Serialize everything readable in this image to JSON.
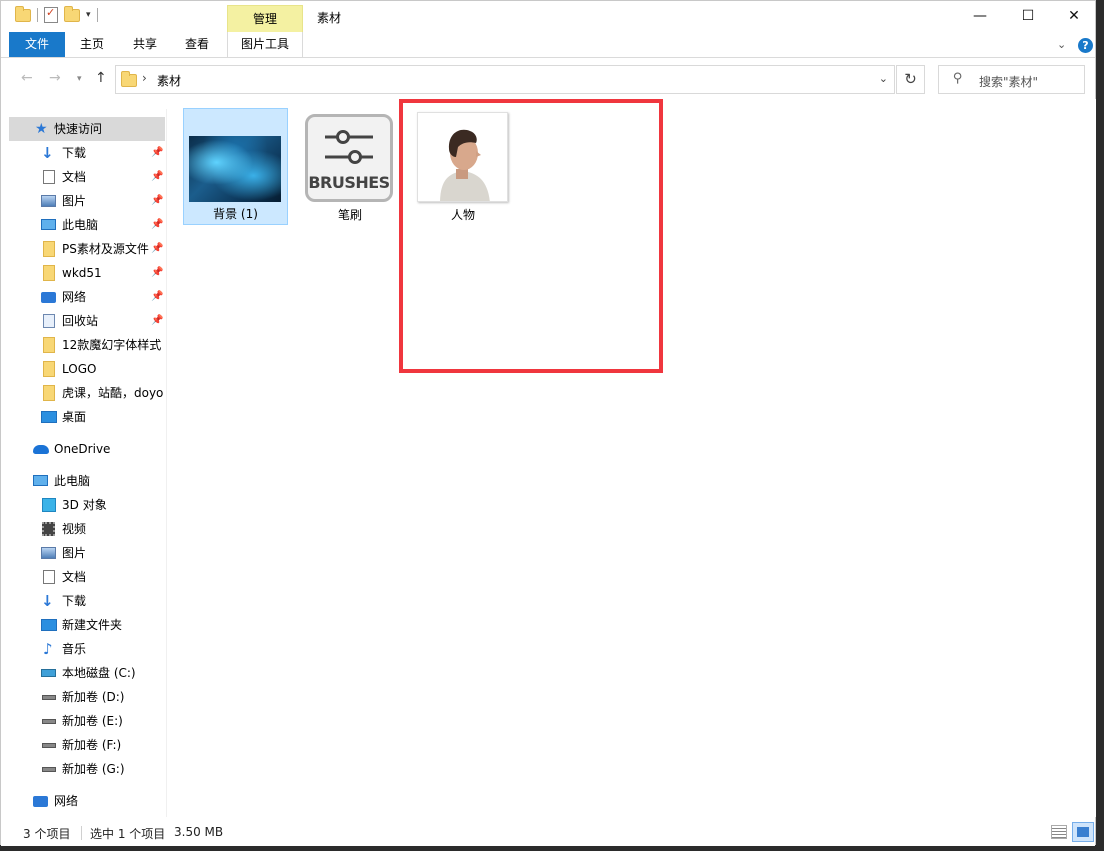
{
  "window": {
    "title": "素材",
    "contextual_tab": "管理",
    "controls": {
      "minimize": "—",
      "maximize": "☐",
      "close": "✕"
    }
  },
  "ribbon": {
    "tabs": [
      "文件",
      "主页",
      "共享",
      "查看",
      "图片工具"
    ],
    "collapse_icon": "chevron-down-icon",
    "help_label": "?"
  },
  "address": {
    "path": "素材",
    "search_placeholder": "搜索\"素材\""
  },
  "sidebar": {
    "quick_access": "快速访问",
    "quick_items": [
      {
        "label": "下载",
        "icon": "download-icon",
        "pinned": true
      },
      {
        "label": "文档",
        "icon": "document-icon",
        "pinned": true
      },
      {
        "label": "图片",
        "icon": "picture-icon",
        "pinned": true
      },
      {
        "label": "此电脑",
        "icon": "computer-icon",
        "pinned": true
      },
      {
        "label": "PS素材及源文件",
        "icon": "folder-icon",
        "pinned": true
      },
      {
        "label": "wkd51",
        "icon": "folder-icon",
        "pinned": true
      },
      {
        "label": "网络",
        "icon": "network-icon",
        "pinned": true
      },
      {
        "label": "回收站",
        "icon": "recycle-bin-icon",
        "pinned": true
      },
      {
        "label": "12款魔幻字体样式",
        "icon": "folder-icon",
        "pinned": false
      },
      {
        "label": "LOGO",
        "icon": "folder-icon",
        "pinned": false
      },
      {
        "label": "虎课，站酷，doyo",
        "icon": "folder-icon",
        "pinned": false
      },
      {
        "label": "桌面",
        "icon": "desktop-icon",
        "pinned": false
      }
    ],
    "onedrive": "OneDrive",
    "this_pc": "此电脑",
    "pc_items": [
      {
        "label": "3D 对象",
        "icon": "3d-objects-icon"
      },
      {
        "label": "视频",
        "icon": "video-icon"
      },
      {
        "label": "图片",
        "icon": "picture-icon"
      },
      {
        "label": "文档",
        "icon": "document-icon"
      },
      {
        "label": "下载",
        "icon": "download-icon"
      },
      {
        "label": "新建文件夹",
        "icon": "desktop-icon"
      },
      {
        "label": "音乐",
        "icon": "music-icon"
      },
      {
        "label": "本地磁盘 (C:)",
        "icon": "system-drive-icon"
      },
      {
        "label": "新加卷 (D:)",
        "icon": "drive-icon"
      },
      {
        "label": "新加卷 (E:)",
        "icon": "drive-icon"
      },
      {
        "label": "新加卷 (F:)",
        "icon": "drive-icon"
      },
      {
        "label": "新加卷 (G:)",
        "icon": "drive-icon"
      }
    ],
    "network": "网络"
  },
  "files": [
    {
      "name": "背景 (1)",
      "type": "image",
      "selected": true
    },
    {
      "name": "笔刷",
      "type": "brushes",
      "thumb_text": "BRUSHES"
    },
    {
      "name": "人物",
      "type": "image"
    }
  ],
  "highlight_color": "#f0363e",
  "status": {
    "count": "3 个项目",
    "selection": "选中 1 个项目",
    "size": "3.50 MB"
  }
}
